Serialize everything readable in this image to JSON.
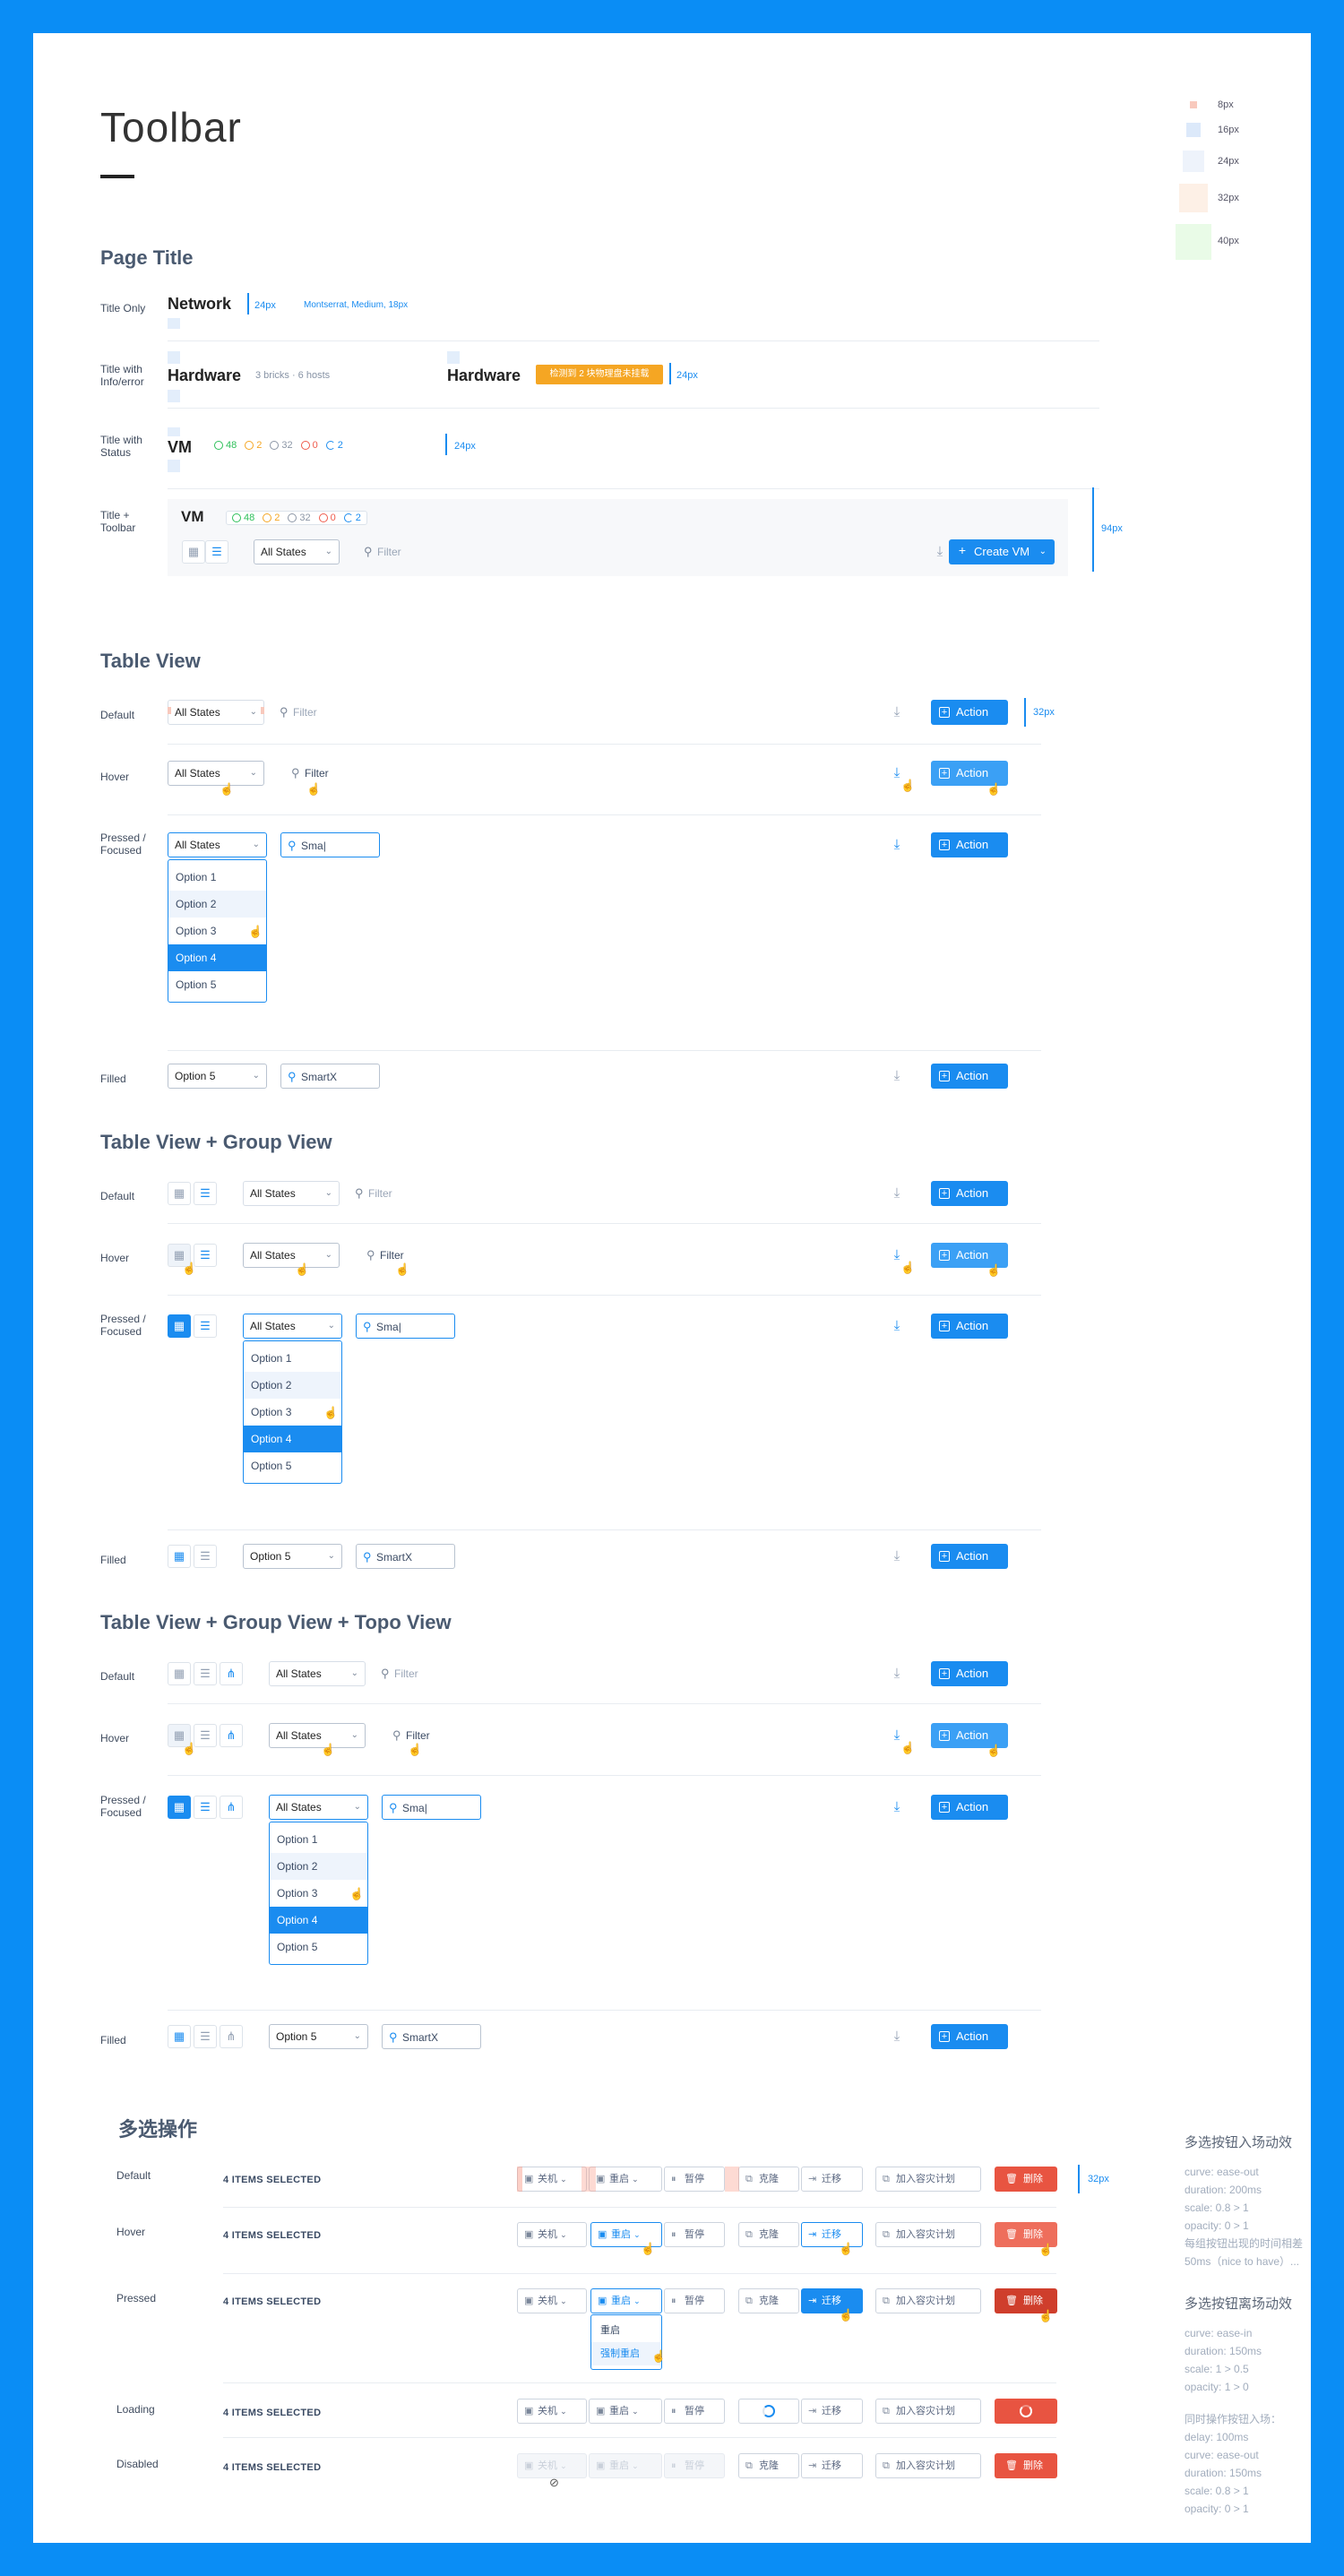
{
  "page_title": "Toolbar",
  "legend": [
    {
      "label": "8px",
      "color": "#f8c9bd"
    },
    {
      "label": "16px",
      "color": "#dce9fa"
    },
    {
      "label": "24px",
      "color": "#eef3fb"
    },
    {
      "label": "32px",
      "color": "#fdf0e6"
    },
    {
      "label": "40px",
      "color": "#e9fbe7"
    }
  ],
  "page_title_section": {
    "heading": "Page Title",
    "rows": [
      {
        "label": "Title Only"
      },
      {
        "label": "Title with Info/error"
      },
      {
        "label": "Title with Status"
      },
      {
        "label": "Title + Toolbar"
      }
    ],
    "title_only": {
      "title": "Network",
      "measure": "24px",
      "font_note": "Montserrat, Medium, 18px"
    },
    "title_info": {
      "title": "Hardware",
      "info": "3 bricks · 6 hosts",
      "title2": "Hardware",
      "error": "检测到 2 块物理盘未挂载",
      "measure": "24px"
    },
    "title_status": {
      "title": "VM",
      "statuses": [
        {
          "value": "48",
          "color": "#2ec05a",
          "icon": "check-icon"
        },
        {
          "value": "2",
          "color": "#f5a623",
          "icon": "warning-icon"
        },
        {
          "value": "32",
          "color": "#8c96a6",
          "icon": "stopped-icon"
        },
        {
          "value": "0",
          "color": "#ef5b4c",
          "icon": "error-icon"
        },
        {
          "value": "2",
          "color": "#1a8cf0",
          "icon": "refresh-icon"
        }
      ],
      "measure": "24px"
    },
    "title_toolbar": {
      "title": "VM",
      "filter_select": "All States",
      "filter_placeholder": "Filter",
      "create_label": "Create VM",
      "measure": "94px"
    }
  },
  "table_view": {
    "heading": "Table View",
    "rows": [
      {
        "label": "Default"
      },
      {
        "label": "Hover"
      },
      {
        "label": "Pressed / Focused"
      },
      {
        "label": "Filled"
      }
    ],
    "select": "All States",
    "filter": "Filter",
    "typed": "Sma",
    "filled_select": "Option 5",
    "filled_search": "SmartX",
    "action": "Action",
    "measure": "32px"
  },
  "options": [
    "Option 1",
    "Option 2",
    "Option 3",
    "Option 4",
    "Option 5"
  ],
  "table_group": {
    "heading": "Table View + Group View"
  },
  "table_group_topo": {
    "heading": "Table View + Group View + Topo View"
  },
  "multi_select": {
    "heading": "多选操作",
    "rows": [
      {
        "label": "Default"
      },
      {
        "label": "Hover"
      },
      {
        "label": "Pressed"
      },
      {
        "label": "Loading"
      },
      {
        "label": "Disabled"
      }
    ],
    "selected_text": "4 ITEMS SELECTED",
    "buttons": {
      "shutdown": "关机",
      "restart": "重启",
      "pause": "暂停",
      "clone": "克隆",
      "migrate": "迁移",
      "dr_plan": "加入容灾计划",
      "delete": "删除"
    },
    "dropdown_items": [
      "重启",
      "强制重启"
    ],
    "measure": "32px"
  },
  "notes": {
    "enter_title": "多选按钮入场动效",
    "enter_lines": [
      "curve: ease-out",
      "duration: 200ms",
      "scale: 0.8 > 1",
      "opacity: 0 > 1",
      "每组按钮出现的时间相差",
      "50ms（nice to have）..."
    ],
    "exit_title": "多选按钮离场动效",
    "exit_lines": [
      "curve: ease-in",
      "duration: 150ms",
      "scale: 1 > 0.5",
      "opacity: 1 > 0",
      "",
      "同时操作按钮入场：",
      "delay: 100ms",
      "curve: ease-out",
      "duration: 150ms",
      "scale: 0.8 > 1",
      "opacity: 0 > 1"
    ]
  },
  "colors": {
    "accent": "#1a8cf0",
    "danger": "#e85441",
    "warning": "#f5a623",
    "frame": "#0a8df5"
  }
}
